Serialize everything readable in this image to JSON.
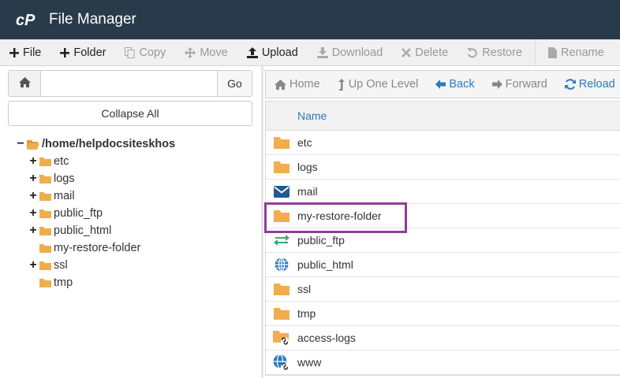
{
  "app": {
    "title": "File Manager",
    "logo_icon": "cpanel-logo-icon"
  },
  "toolbar": {
    "items": [
      {
        "label": "File",
        "icon": "plus-icon",
        "enabled": true
      },
      {
        "label": "Folder",
        "icon": "plus-icon",
        "enabled": true
      },
      {
        "label": "Copy",
        "icon": "copy-icon",
        "enabled": false
      },
      {
        "label": "Move",
        "icon": "move-icon",
        "enabled": false
      },
      {
        "label": "Upload",
        "icon": "upload-icon",
        "enabled": true
      },
      {
        "label": "Download",
        "icon": "download-icon",
        "enabled": false
      },
      {
        "label": "Delete",
        "icon": "delete-icon",
        "enabled": false
      },
      {
        "label": "Restore",
        "icon": "restore-icon",
        "enabled": false
      },
      {
        "label": "Rename",
        "icon": "rename-icon",
        "enabled": false
      }
    ]
  },
  "path": {
    "value": "",
    "go_label": "Go",
    "home_icon": "home-icon"
  },
  "collapse_label": "Collapse All",
  "tree": {
    "root": "/home/helpdocsiteskhos",
    "items": [
      {
        "label": "etc",
        "expandable": true
      },
      {
        "label": "logs",
        "expandable": true
      },
      {
        "label": "mail",
        "expandable": true
      },
      {
        "label": "public_ftp",
        "expandable": true
      },
      {
        "label": "public_html",
        "expandable": true
      },
      {
        "label": "my-restore-folder",
        "expandable": false
      },
      {
        "label": "ssl",
        "expandable": true
      },
      {
        "label": "tmp",
        "expandable": false
      }
    ]
  },
  "nav": {
    "items": [
      {
        "label": "Home",
        "icon": "home-icon",
        "active": false
      },
      {
        "label": "Up One Level",
        "icon": "up-level-icon",
        "active": false
      },
      {
        "label": "Back",
        "icon": "arrow-left-icon",
        "active": true
      },
      {
        "label": "Forward",
        "icon": "arrow-right-icon",
        "active": false
      },
      {
        "label": "Reload",
        "icon": "reload-icon",
        "active": true
      }
    ]
  },
  "table": {
    "column_name": "Name",
    "rows": [
      {
        "name": "etc",
        "icon": "folder-icon"
      },
      {
        "name": "logs",
        "icon": "folder-icon"
      },
      {
        "name": "mail",
        "icon": "mail-icon"
      },
      {
        "name": "my-restore-folder",
        "icon": "folder-icon",
        "highlighted": true
      },
      {
        "name": "public_ftp",
        "icon": "ftp-transfer-icon"
      },
      {
        "name": "public_html",
        "icon": "globe-icon"
      },
      {
        "name": "ssl",
        "icon": "folder-icon"
      },
      {
        "name": "tmp",
        "icon": "folder-icon"
      },
      {
        "name": "access-logs",
        "icon": "folder-link-icon"
      },
      {
        "name": "www",
        "icon": "globe-link-icon"
      }
    ]
  },
  "colors": {
    "titlebar": "#293a4a",
    "accent": "#2a7ac0",
    "folder": "#f0ad4e",
    "highlight": "#8e3d99",
    "ftp": "#3aa76d"
  }
}
